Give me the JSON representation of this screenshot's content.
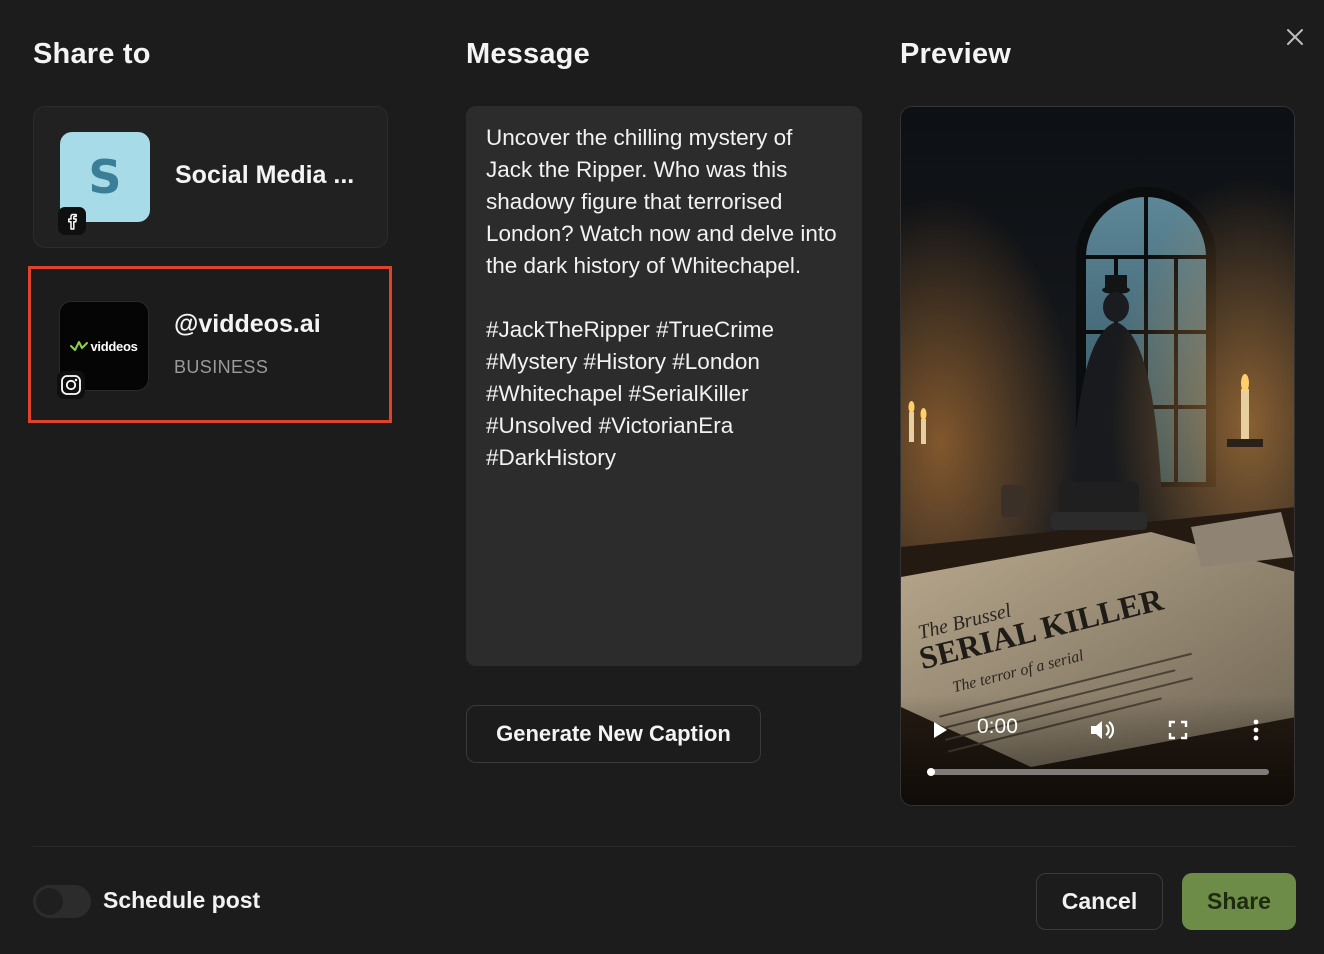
{
  "headers": {
    "share_to": "Share to",
    "message": "Message",
    "preview": "Preview"
  },
  "accounts": [
    {
      "name": "Social Media ...",
      "avatar_letter": "S",
      "platform": "facebook",
      "platform_icon": "facebook-icon",
      "selected": false
    },
    {
      "name": "@viddeos.ai",
      "type": "BUSINESS",
      "avatar_logo_text": "viddeos",
      "platform": "instagram",
      "platform_icon": "instagram-icon",
      "selected": true
    }
  ],
  "message": {
    "text": "Uncover the chilling mystery of Jack the Ripper. Who was this shadowy figure that terrorised London? Watch now and delve into the dark history of Whitechapel.\n\n#JackTheRipper #TrueCrime #Mystery #History #London #Whitechapel #SerialKiller #Unsolved #VictorianEra #DarkHistory",
    "generate_button": "Generate New Caption"
  },
  "preview": {
    "time": "0:00",
    "progress": 0,
    "newspaper_headline": "SERIAL KILLER",
    "controls": [
      "play-icon",
      "volume-icon",
      "fullscreen-icon",
      "more-vertical-icon"
    ]
  },
  "footer": {
    "schedule_label": "Schedule post",
    "schedule_enabled": false,
    "cancel": "Cancel",
    "share": "Share"
  },
  "colors": {
    "background": "#1c1c1c",
    "selection_outline": "#e0422b",
    "share_button": "#6c8c47",
    "avatar_s_bg": "#a7dbe8"
  }
}
